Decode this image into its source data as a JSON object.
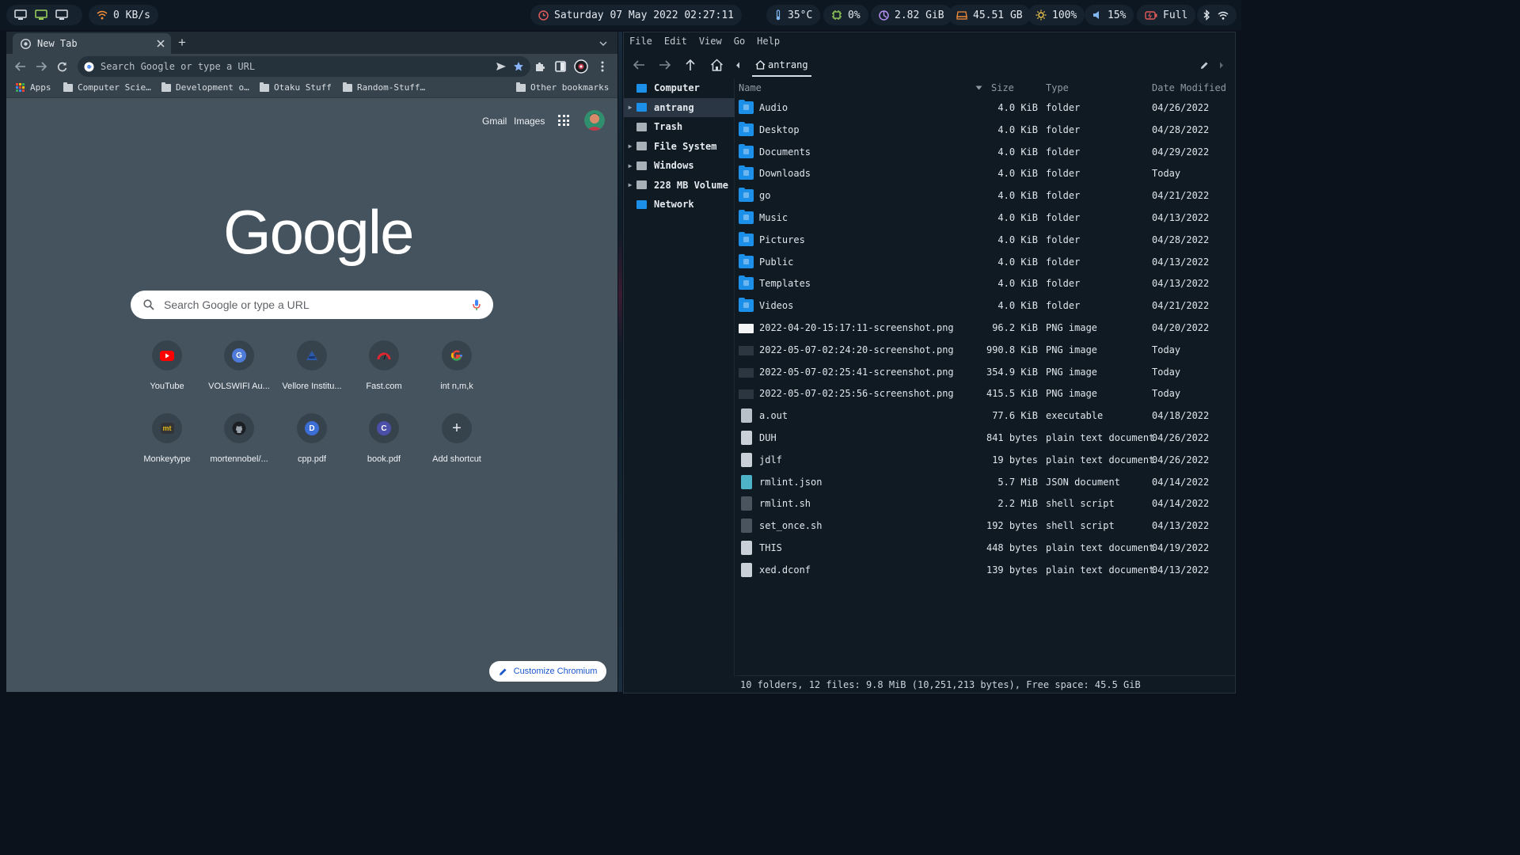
{
  "topbar": {
    "net_speed": "0 KB/s",
    "datetime": "Saturday 07 May 2022 02:27:11",
    "temperature": "35°C",
    "cpu": "0%",
    "memory": "2.82 GiB",
    "disk": "45.51 GB",
    "brightness": "100%",
    "volume": "15%",
    "battery": "Full",
    "accent": "#9bd35a"
  },
  "browser": {
    "tab_title": "New Tab",
    "omnibox_placeholder": "Search Google or type a URL",
    "bookmarks": [
      "Apps",
      "Computer Scie…",
      "Development o…",
      "Otaku Stuff",
      "Random-Stuff…"
    ],
    "other_bookmarks": "Other bookmarks",
    "ntp": {
      "gmail": "Gmail",
      "images": "Images",
      "logo": "Google",
      "search_placeholder": "Search Google or type a URL",
      "shortcuts": [
        {
          "label": "YouTube",
          "glyph": "▶",
          "color": "#ff0000"
        },
        {
          "label": "VOLSWIFI Au...",
          "glyph": "G",
          "color": "#4f7bd8"
        },
        {
          "label": "Vellore Institu...",
          "glyph": "◆",
          "color": "#2b5aa8"
        },
        {
          "label": "Fast.com",
          "glyph": "◠",
          "color": "#e0262e"
        },
        {
          "label": "int n,m,k",
          "glyph": "G",
          "color": "#ea4335"
        },
        {
          "label": "Monkeytype",
          "glyph": "mt",
          "color": "#e2b714"
        },
        {
          "label": "mortennobel/...",
          "glyph": "●",
          "color": "#24292f"
        },
        {
          "label": "cpp.pdf",
          "glyph": "D",
          "color": "#3d6ed6"
        },
        {
          "label": "book.pdf",
          "glyph": "C",
          "color": "#4b4fa8"
        },
        {
          "label": "Add shortcut",
          "glyph": "+",
          "color": "#e6eaee"
        }
      ],
      "customize": "Customize Chromium"
    }
  },
  "filemanager": {
    "menu": [
      "File",
      "Edit",
      "View",
      "Go",
      "Help"
    ],
    "breadcrumb": "antrang",
    "sidebar": [
      {
        "label": "Computer",
        "expander": false,
        "color": "#1c8fe8"
      },
      {
        "label": "antrang",
        "expander": true,
        "color": "#1c8fe8"
      },
      {
        "label": "Trash",
        "expander": false,
        "color": "#a8b0b8"
      },
      {
        "label": "File System",
        "expander": true,
        "color": "#a8b0b8"
      },
      {
        "label": "Windows",
        "expander": true,
        "color": "#a8b0b8"
      },
      {
        "label": "228 MB Volume",
        "expander": true,
        "color": "#a8b0b8"
      },
      {
        "label": "Network",
        "expander": false,
        "color": "#1c8fe8"
      }
    ],
    "columns": {
      "name": "Name",
      "size": "Size",
      "type": "Type",
      "date": "Date Modified"
    },
    "files": [
      {
        "name": "Audio",
        "size": "4.0 KiB",
        "type": "folder",
        "date": "04/26/2022",
        "icon": "folder"
      },
      {
        "name": "Desktop",
        "size": "4.0 KiB",
        "type": "folder",
        "date": "04/28/2022",
        "icon": "folder"
      },
      {
        "name": "Documents",
        "size": "4.0 KiB",
        "type": "folder",
        "date": "04/29/2022",
        "icon": "folder"
      },
      {
        "name": "Downloads",
        "size": "4.0 KiB",
        "type": "folder",
        "date": "Today",
        "icon": "folder"
      },
      {
        "name": "go",
        "size": "4.0 KiB",
        "type": "folder",
        "date": "04/21/2022",
        "icon": "folder"
      },
      {
        "name": "Music",
        "size": "4.0 KiB",
        "type": "folder",
        "date": "04/13/2022",
        "icon": "folder"
      },
      {
        "name": "Pictures",
        "size": "4.0 KiB",
        "type": "folder",
        "date": "04/28/2022",
        "icon": "folder"
      },
      {
        "name": "Public",
        "size": "4.0 KiB",
        "type": "folder",
        "date": "04/13/2022",
        "icon": "folder"
      },
      {
        "name": "Templates",
        "size": "4.0 KiB",
        "type": "folder",
        "date": "04/13/2022",
        "icon": "folder"
      },
      {
        "name": "Videos",
        "size": "4.0 KiB",
        "type": "folder",
        "date": "04/21/2022",
        "icon": "folder"
      },
      {
        "name": "2022-04-20-15:17:11-screenshot.png",
        "size": "96.2 KiB",
        "type": "PNG image",
        "date": "04/20/2022",
        "icon": "image-light"
      },
      {
        "name": "2022-05-07-02:24:20-screenshot.png",
        "size": "990.8 KiB",
        "type": "PNG image",
        "date": "Today",
        "icon": "image-dark"
      },
      {
        "name": "2022-05-07-02:25:41-screenshot.png",
        "size": "354.9 KiB",
        "type": "PNG image",
        "date": "Today",
        "icon": "image-dark"
      },
      {
        "name": "2022-05-07-02:25:56-screenshot.png",
        "size": "415.5 KiB",
        "type": "PNG image",
        "date": "Today",
        "icon": "image-dark"
      },
      {
        "name": "a.out",
        "size": "77.6 KiB",
        "type": "executable",
        "date": "04/18/2022",
        "icon": "executable"
      },
      {
        "name": "DUH",
        "size": "841 bytes",
        "type": "plain text document",
        "date": "04/26/2022",
        "icon": "text"
      },
      {
        "name": "jdlf",
        "size": "19 bytes",
        "type": "plain text document",
        "date": "04/26/2022",
        "icon": "text"
      },
      {
        "name": "rmlint.json",
        "size": "5.7 MiB",
        "type": "JSON document",
        "date": "04/14/2022",
        "icon": "json"
      },
      {
        "name": "rmlint.sh",
        "size": "2.2 MiB",
        "type": "shell script",
        "date": "04/14/2022",
        "icon": "script"
      },
      {
        "name": "set_once.sh",
        "size": "192 bytes",
        "type": "shell script",
        "date": "04/13/2022",
        "icon": "script"
      },
      {
        "name": "THIS",
        "size": "448 bytes",
        "type": "plain text document",
        "date": "04/19/2022",
        "icon": "text"
      },
      {
        "name": "xed.dconf",
        "size": "139 bytes",
        "type": "plain text document",
        "date": "04/13/2022",
        "icon": "text"
      }
    ],
    "status": "10 folders, 12 files: 9.8 MiB (10,251,213 bytes), Free space: 45.5 GiB"
  }
}
